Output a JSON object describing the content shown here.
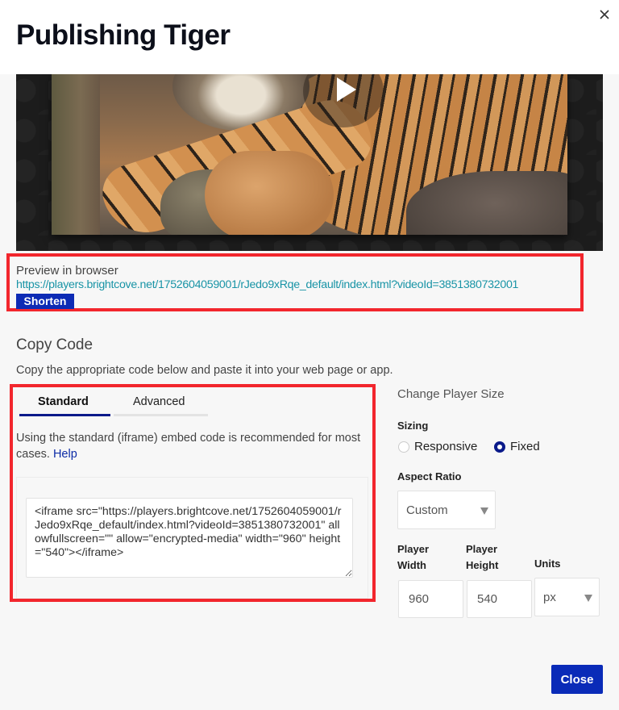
{
  "dialog": {
    "title": "Publishing Tiger",
    "close_icon": "close-icon"
  },
  "video": {
    "subject": "tiger",
    "play_icon": "play-icon"
  },
  "preview": {
    "label": "Preview in browser",
    "url": "https://players.brightcove.net/1752604059001/rJedo9xRqe_default/index.html?videoId=3851380732001",
    "shorten_label": "Shorten"
  },
  "copy_code": {
    "title": "Copy Code",
    "description": "Copy the appropriate code below and paste it into your web page or app.",
    "tabs": [
      {
        "label": "Standard",
        "active": true
      },
      {
        "label": "Advanced",
        "active": false
      }
    ],
    "embed_description": "Using the standard (iframe) embed code is recommended for most cases.",
    "help_label": "Help",
    "embed_code": "<iframe src=\"https://players.brightcove.net/1752604059001/rJedo9xRqe_default/index.html?videoId=3851380732001\" allowfullscreen=\"\" allow=\"encrypted-media\" width=\"960\" height=\"540\"></iframe>"
  },
  "player_size": {
    "title": "Change Player Size",
    "sizing_label": "Sizing",
    "sizing_options": [
      {
        "label": "Responsive",
        "selected": false
      },
      {
        "label": "Fixed",
        "selected": true
      }
    ],
    "aspect_ratio_label": "Aspect Ratio",
    "aspect_ratio_value": "Custom",
    "width_label": "Player Width",
    "width_value": "960",
    "height_label": "Player Height",
    "height_value": "540",
    "units_label": "Units",
    "units_value": "px"
  },
  "footer": {
    "close_label": "Close"
  },
  "colors": {
    "primary_button": "#0a2bb8",
    "link": "#1994a6",
    "highlight_border": "#f2262d",
    "active_tab": "#0a1a8a"
  }
}
